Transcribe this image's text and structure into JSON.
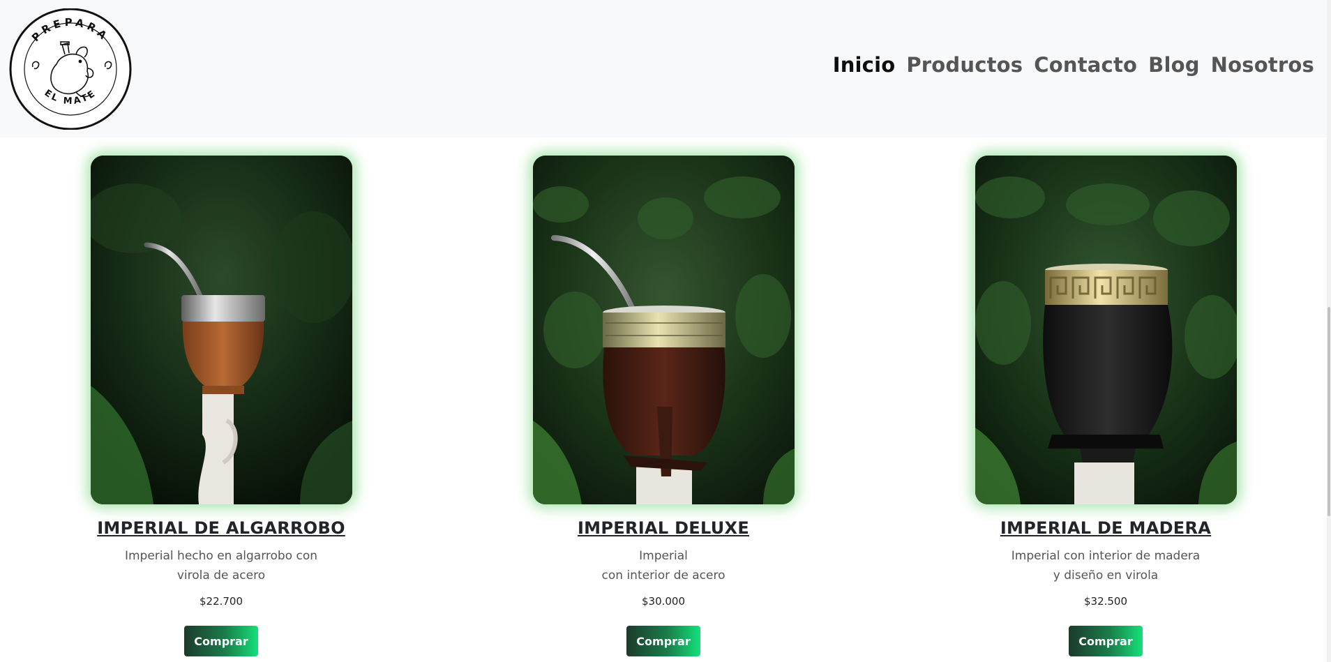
{
  "header": {
    "logo": {
      "top_text": "PREPARA",
      "bottom_text": "EL MATE"
    },
    "nav": [
      {
        "label": "Inicio",
        "active": true
      },
      {
        "label": "Productos",
        "active": false
      },
      {
        "label": "Contacto",
        "active": false
      },
      {
        "label": "Blog",
        "active": false
      },
      {
        "label": "Nosotros",
        "active": false
      }
    ]
  },
  "products": [
    {
      "title": "IMPERIAL DE ALGARROBO",
      "desc_line1": "Imperial hecho en algarrobo con",
      "desc_line2": "virola de acero",
      "price": "$22.700",
      "button": "Comprar"
    },
    {
      "title": "IMPERIAL DELUXE",
      "desc_line1": "Imperial",
      "desc_line2": "con interior de acero",
      "price": "$30.000",
      "button": "Comprar"
    },
    {
      "title": "IMPERIAL DE MADERA",
      "desc_line1": "Imperial con interior de madera",
      "desc_line2": "y diseño en virola",
      "price": "$32.500",
      "button": "Comprar"
    }
  ],
  "colors": {
    "header_bg": "#f8f9fa",
    "nav_active": "#0d0d0d",
    "nav_inactive": "#555555",
    "card_glow": "#46c850",
    "button_gradient_start": "#1d3a2c",
    "button_gradient_end": "#14e07a"
  }
}
